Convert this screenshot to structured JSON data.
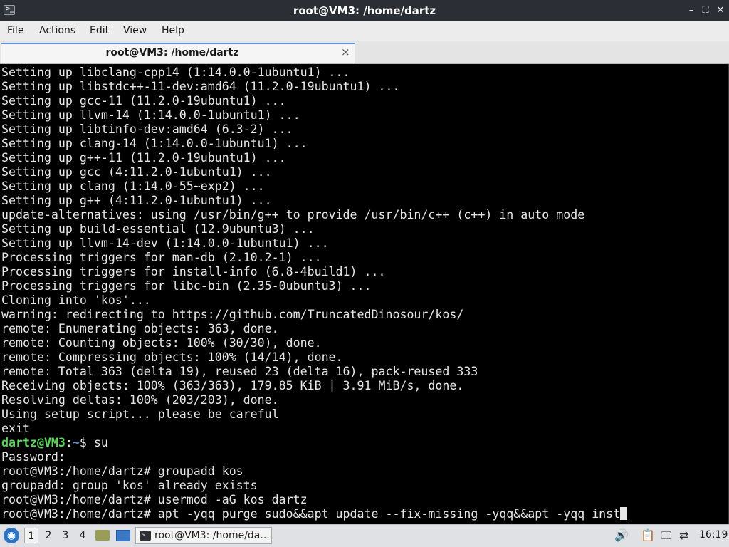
{
  "window": {
    "title": "root@VM3: /home/dartz",
    "controls": {
      "minimize": "–",
      "maximize": "⛶",
      "close": "✕"
    }
  },
  "menu": {
    "items": [
      "File",
      "Actions",
      "Edit",
      "View",
      "Help"
    ]
  },
  "tabs": [
    {
      "label": "root@VM3: /home/dartz",
      "close": "×"
    }
  ],
  "terminal": {
    "lines": [
      "Setting up libclang-cpp14 (1:14.0.0-1ubuntu1) ...",
      "Setting up libstdc++-11-dev:amd64 (11.2.0-19ubuntu1) ...",
      "Setting up gcc-11 (11.2.0-19ubuntu1) ...",
      "Setting up llvm-14 (1:14.0.0-1ubuntu1) ...",
      "Setting up libtinfo-dev:amd64 (6.3-2) ...",
      "Setting up clang-14 (1:14.0.0-1ubuntu1) ...",
      "Setting up g++-11 (11.2.0-19ubuntu1) ...",
      "Setting up gcc (4:11.2.0-1ubuntu1) ...",
      "Setting up clang (1:14.0-55~exp2) ...",
      "Setting up g++ (4:11.2.0-1ubuntu1) ...",
      "update-alternatives: using /usr/bin/g++ to provide /usr/bin/c++ (c++) in auto mode",
      "Setting up build-essential (12.9ubuntu3) ...",
      "Setting up llvm-14-dev (1:14.0.0-1ubuntu1) ...",
      "Processing triggers for man-db (2.10.2-1) ...",
      "Processing triggers for install-info (6.8-4build1) ...",
      "Processing triggers for libc-bin (2.35-0ubuntu3) ...",
      "Cloning into 'kos'...",
      "warning: redirecting to https://github.com/TruncatedDinosour/kos/",
      "remote: Enumerating objects: 363, done.",
      "remote: Counting objects: 100% (30/30), done.",
      "remote: Compressing objects: 100% (14/14), done.",
      "remote: Total 363 (delta 19), reused 23 (delta 16), pack-reused 333",
      "Receiving objects: 100% (363/363), 179.85 KiB | 3.91 MiB/s, done.",
      "Resolving deltas: 100% (203/203), done.",
      "Using setup script... please be careful",
      "exit"
    ],
    "user_prompt": {
      "user_host": "dartz@VM3",
      "colon": ":",
      "dir": "~",
      "symbol": "$ ",
      "command": "su"
    },
    "lines_after": [
      "Password:",
      "root@VM3:/home/dartz# groupadd kos",
      "groupadd: group 'kos' already exists",
      "root@VM3:/home/dartz# usermod -aG kos dartz"
    ],
    "current_line": "root@VM3:/home/dartz# apt -yqq purge sudo&&apt update --fix-missing -yqq&&apt -yqq inst"
  },
  "taskbar": {
    "workspaces": [
      "1",
      "2",
      "3",
      "4"
    ],
    "active_workspace": "1",
    "task_label": "root@VM3: /home/da...",
    "clock": "16:19",
    "icons": [
      "start-menu-icon",
      "file-manager-icon",
      "show-desktop-icon",
      "terminal-icon",
      "volume-icon",
      "clipboard-icon",
      "display-icon",
      "network-icon"
    ]
  }
}
